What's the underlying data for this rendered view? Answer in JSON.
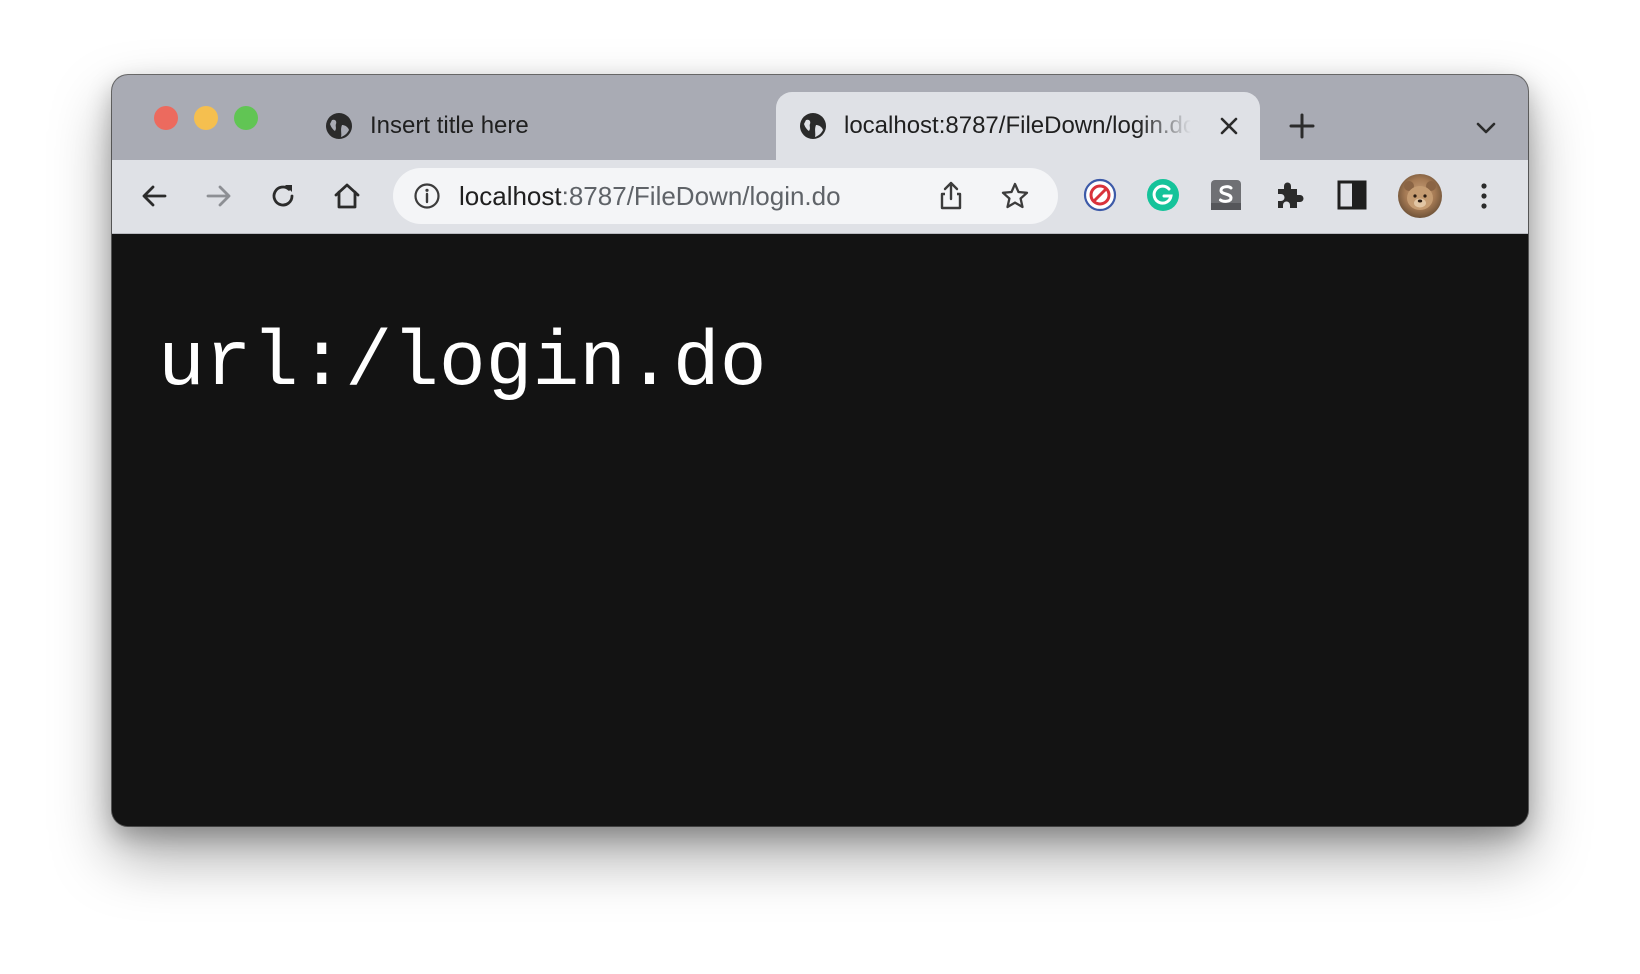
{
  "tabs": [
    {
      "title": "Insert title here",
      "active": false,
      "favicon": "globe-icon"
    },
    {
      "title": "localhost:8787/FileDown/login.do",
      "active": true,
      "favicon": "globe-icon"
    }
  ],
  "omnibox": {
    "host": "localhost",
    "path": ":8787/FileDown/login.do"
  },
  "page": {
    "text": "url:/login.do"
  },
  "extensions": [
    "block-extension-icon",
    "grammarly-extension-icon",
    "s-extension-icon",
    "puzzle-extensions-icon",
    "side-panel-icon"
  ],
  "colors": {
    "tabstrip": "#a9abb4",
    "toolbar": "#dfe1e6",
    "page_background": "#131313",
    "page_text": "#ffffff"
  }
}
